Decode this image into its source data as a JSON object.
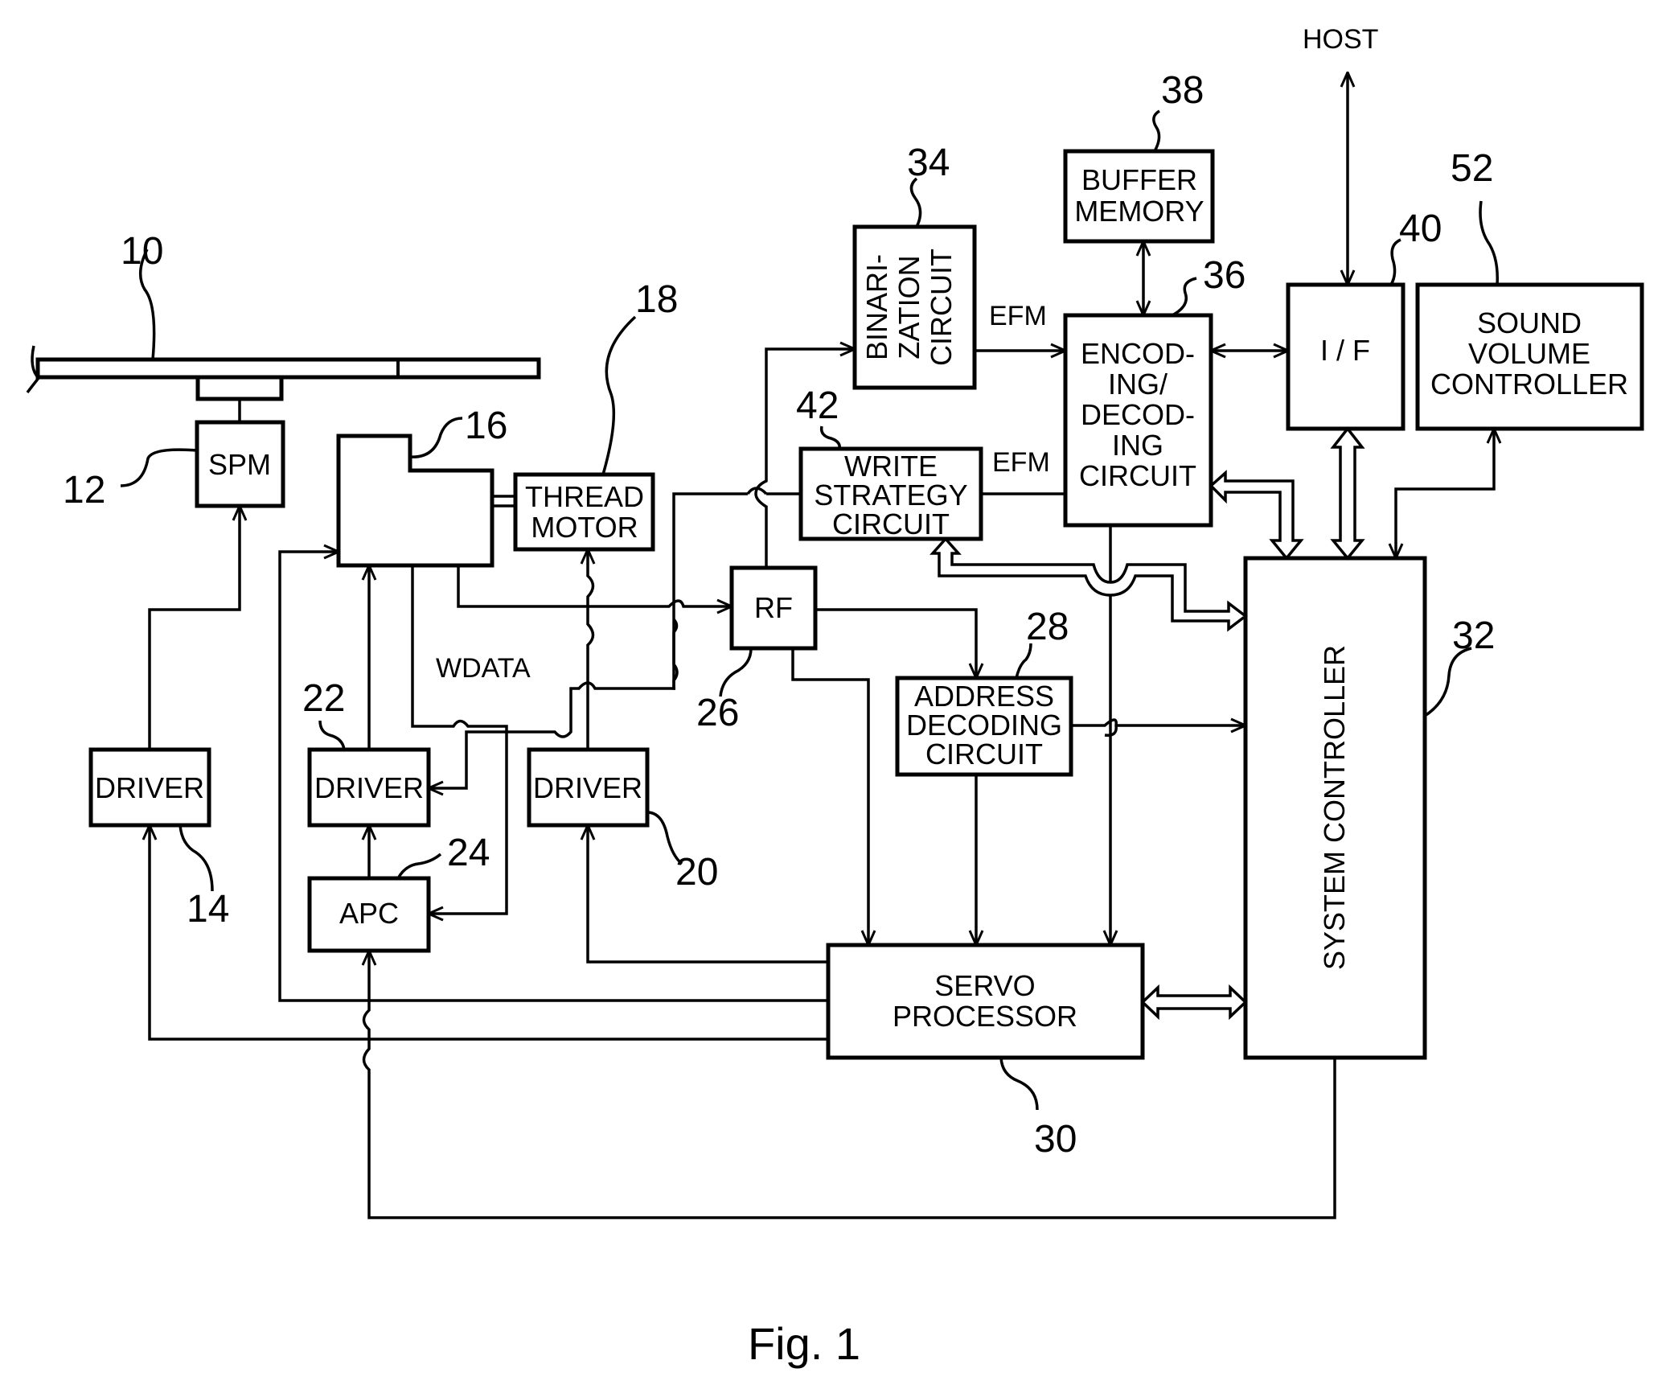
{
  "figure": {
    "caption": "Fig. 1",
    "external": "HOST"
  },
  "blocks": {
    "disc": {
      "ref": "10"
    },
    "spm": {
      "label": "SPM",
      "ref": "12"
    },
    "spm_driver": {
      "label": "DRIVER",
      "ref": "14"
    },
    "pickup": {
      "ref": "16"
    },
    "thread_motor": {
      "line1": "THREAD",
      "line2": "MOTOR",
      "ref": "18"
    },
    "thread_driver": {
      "label": "DRIVER",
      "ref": "20"
    },
    "laser_driver": {
      "label": "DRIVER",
      "ref": "22"
    },
    "apc": {
      "label": "APC",
      "ref": "24"
    },
    "rf": {
      "label": "RF",
      "ref": "26"
    },
    "address_decoding": {
      "line1": "ADDRESS",
      "line2": "DECODING",
      "line3": "CIRCUIT",
      "ref": "28"
    },
    "servo_processor": {
      "line1": "SERVO",
      "line2": "PROCESSOR",
      "ref": "30"
    },
    "system_controller": {
      "label": "SYSTEM CONTROLLER",
      "ref": "32"
    },
    "binarization": {
      "line1": "BINARI-",
      "line2": "ZATION",
      "line3": "CIRCUIT",
      "ref": "34"
    },
    "encoding_decoding": {
      "line1": "ENCOD-",
      "line2": "ING/",
      "line3": "DECOD-",
      "line4": "ING",
      "line5": "CIRCUIT",
      "ref": "36"
    },
    "buffer_memory": {
      "line1": "BUFFER",
      "line2": "MEMORY",
      "ref": "38"
    },
    "interface": {
      "label": "I / F",
      "ref": "40"
    },
    "write_strategy": {
      "line1": "WRITE",
      "line2": "STRATEGY",
      "line3": "CIRCUIT",
      "ref": "42"
    },
    "sound_volume": {
      "line1": "SOUND",
      "line2": "VOLUME",
      "line3": "CONTROLLER",
      "ref": "52"
    }
  },
  "signals": {
    "efm_read": "EFM",
    "efm_write": "EFM",
    "wdata": "WDATA"
  }
}
